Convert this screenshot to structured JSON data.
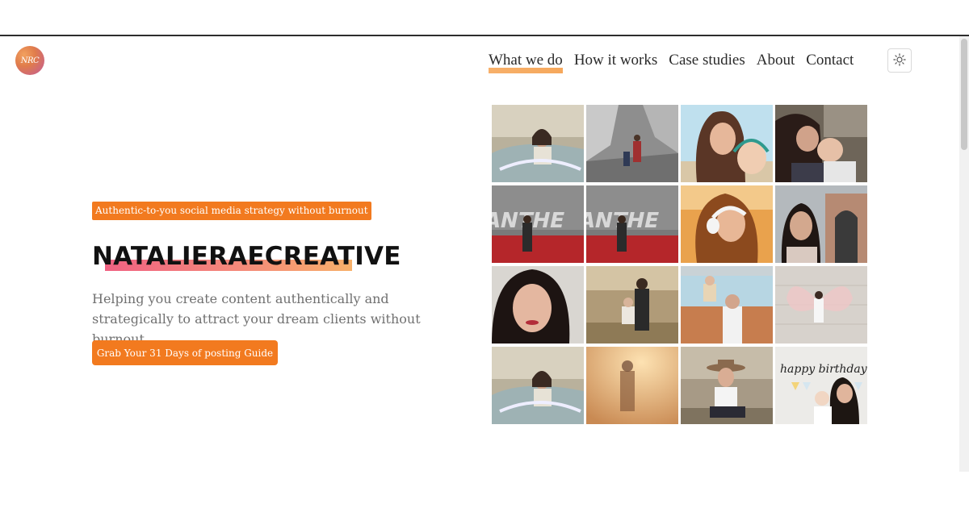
{
  "logo": {
    "text": "NRC"
  },
  "nav": {
    "items": [
      {
        "label": "What we do",
        "active": true
      },
      {
        "label": "How it works",
        "active": false
      },
      {
        "label": "Case studies",
        "active": false
      },
      {
        "label": "About",
        "active": false
      },
      {
        "label": "Contact",
        "active": false
      }
    ],
    "theme_toggle_icon": "sun-icon"
  },
  "hero": {
    "badge": "Authentic-to-you social media strategy without burnout",
    "headline": "NATALIERAECREATIVE",
    "lede": "Helping you create content authentically and strategically to attract your dream clients without burnout.",
    "cta": "Grab Your 31 Days of posting Guide"
  },
  "gallery": {
    "photos": [
      {
        "subject": "woman-in-vintage-car"
      },
      {
        "subject": "mother-and-child-on-rocky-trail"
      },
      {
        "subject": "mother-and-daughter-selfie"
      },
      {
        "subject": "mother-kissing-child"
      },
      {
        "subject": "woman-speaking-anthem-sign"
      },
      {
        "subject": "woman-speaking-anthem-sign"
      },
      {
        "subject": "woman-with-headphones"
      },
      {
        "subject": "woman-smiling-by-doorway"
      },
      {
        "subject": "woman-close-up-selfie"
      },
      {
        "subject": "mother-holding-child-outdoors"
      },
      {
        "subject": "woman-with-child-on-shoulders"
      },
      {
        "subject": "child-with-chalk-wings"
      },
      {
        "subject": "woman-in-vintage-car"
      },
      {
        "subject": "woman-in-golden-light"
      },
      {
        "subject": "woman-in-hat-in-desert"
      },
      {
        "subject": "birthday-mother-and-baby",
        "overlay_text": "happy birthday"
      }
    ]
  },
  "colors": {
    "accent": "#f27a1f",
    "highlight_start": "#f06282",
    "highlight_end": "#f7b06a",
    "text": "#2a2a2a",
    "muted": "#707070"
  }
}
